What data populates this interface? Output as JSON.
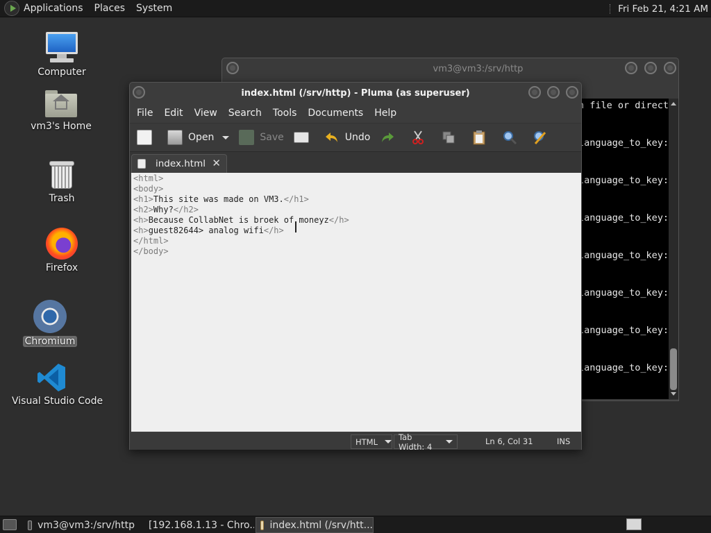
{
  "top_panel": {
    "menus": [
      "Applications",
      "Places",
      "System"
    ],
    "clock": "Fri Feb 21,  4:21 AM"
  },
  "desktop": {
    "icons": [
      {
        "label": "Computer",
        "icon": "computer-icon"
      },
      {
        "label": "vm3's Home",
        "icon": "home-folder-icon"
      },
      {
        "label": "Trash",
        "icon": "trash-icon"
      },
      {
        "label": "Firefox",
        "icon": "firefox-icon"
      },
      {
        "label": "Chromium",
        "icon": "chromium-icon",
        "selected": true
      },
      {
        "label": "Visual Studio Code",
        "icon": "vscode-icon"
      }
    ]
  },
  "terminal": {
    "title": "vm3@vm3:/srv/http",
    "lines": [
      "n file or direct",
      "language_to_key:",
      "language_to_key:",
      "language_to_key:",
      "language_to_key:",
      "language_to_key:",
      "language_to_key:",
      "language_to_key:"
    ]
  },
  "pluma": {
    "title": "index.html (/srv/http) - Pluma (as superuser)",
    "menu": [
      "File",
      "Edit",
      "View",
      "Search",
      "Tools",
      "Documents",
      "Help"
    ],
    "toolbar": {
      "open": "Open",
      "save": "Save",
      "undo": "Undo"
    },
    "tab": "index.html",
    "code": [
      [
        {
          "t": "tag",
          "s": "<html>"
        }
      ],
      [
        {
          "t": "tag",
          "s": "<body>"
        }
      ],
      [
        {
          "t": "tag",
          "s": "<h1>"
        },
        {
          "t": "txt",
          "s": "This site was made on VM3."
        },
        {
          "t": "tag",
          "s": "</h1>"
        }
      ],
      [
        {
          "t": "tag",
          "s": "<h2>"
        },
        {
          "t": "txt",
          "s": "Why?"
        },
        {
          "t": "tag",
          "s": "</h2>"
        }
      ],
      [
        {
          "t": "tag",
          "s": "<h>"
        },
        {
          "t": "txt",
          "s": "Because CollabNet is broek of moneyz"
        },
        {
          "t": "tag",
          "s": "</h>"
        }
      ],
      [
        {
          "t": "tag",
          "s": "<h>"
        },
        {
          "t": "txt",
          "s": "guest82644> analog wifi"
        },
        {
          "t": "tag",
          "s": "</h>"
        }
      ],
      [
        {
          "t": "tag",
          "s": "</html>"
        }
      ],
      [
        {
          "t": "tag",
          "s": "</body>"
        }
      ]
    ],
    "status": {
      "language": "HTML",
      "tab_width": "Tab Width:  4",
      "position": "Ln 6, Col 31",
      "mode": "INS"
    }
  },
  "taskbar": [
    {
      "label": "vm3@vm3:/srv/http",
      "icon": "terminal-icon"
    },
    {
      "label": "[192.168.1.13 - Chro...",
      "icon": "chromium-icon"
    },
    {
      "label": "index.html (/srv/htt...",
      "icon": "pluma-icon",
      "active": true
    }
  ]
}
